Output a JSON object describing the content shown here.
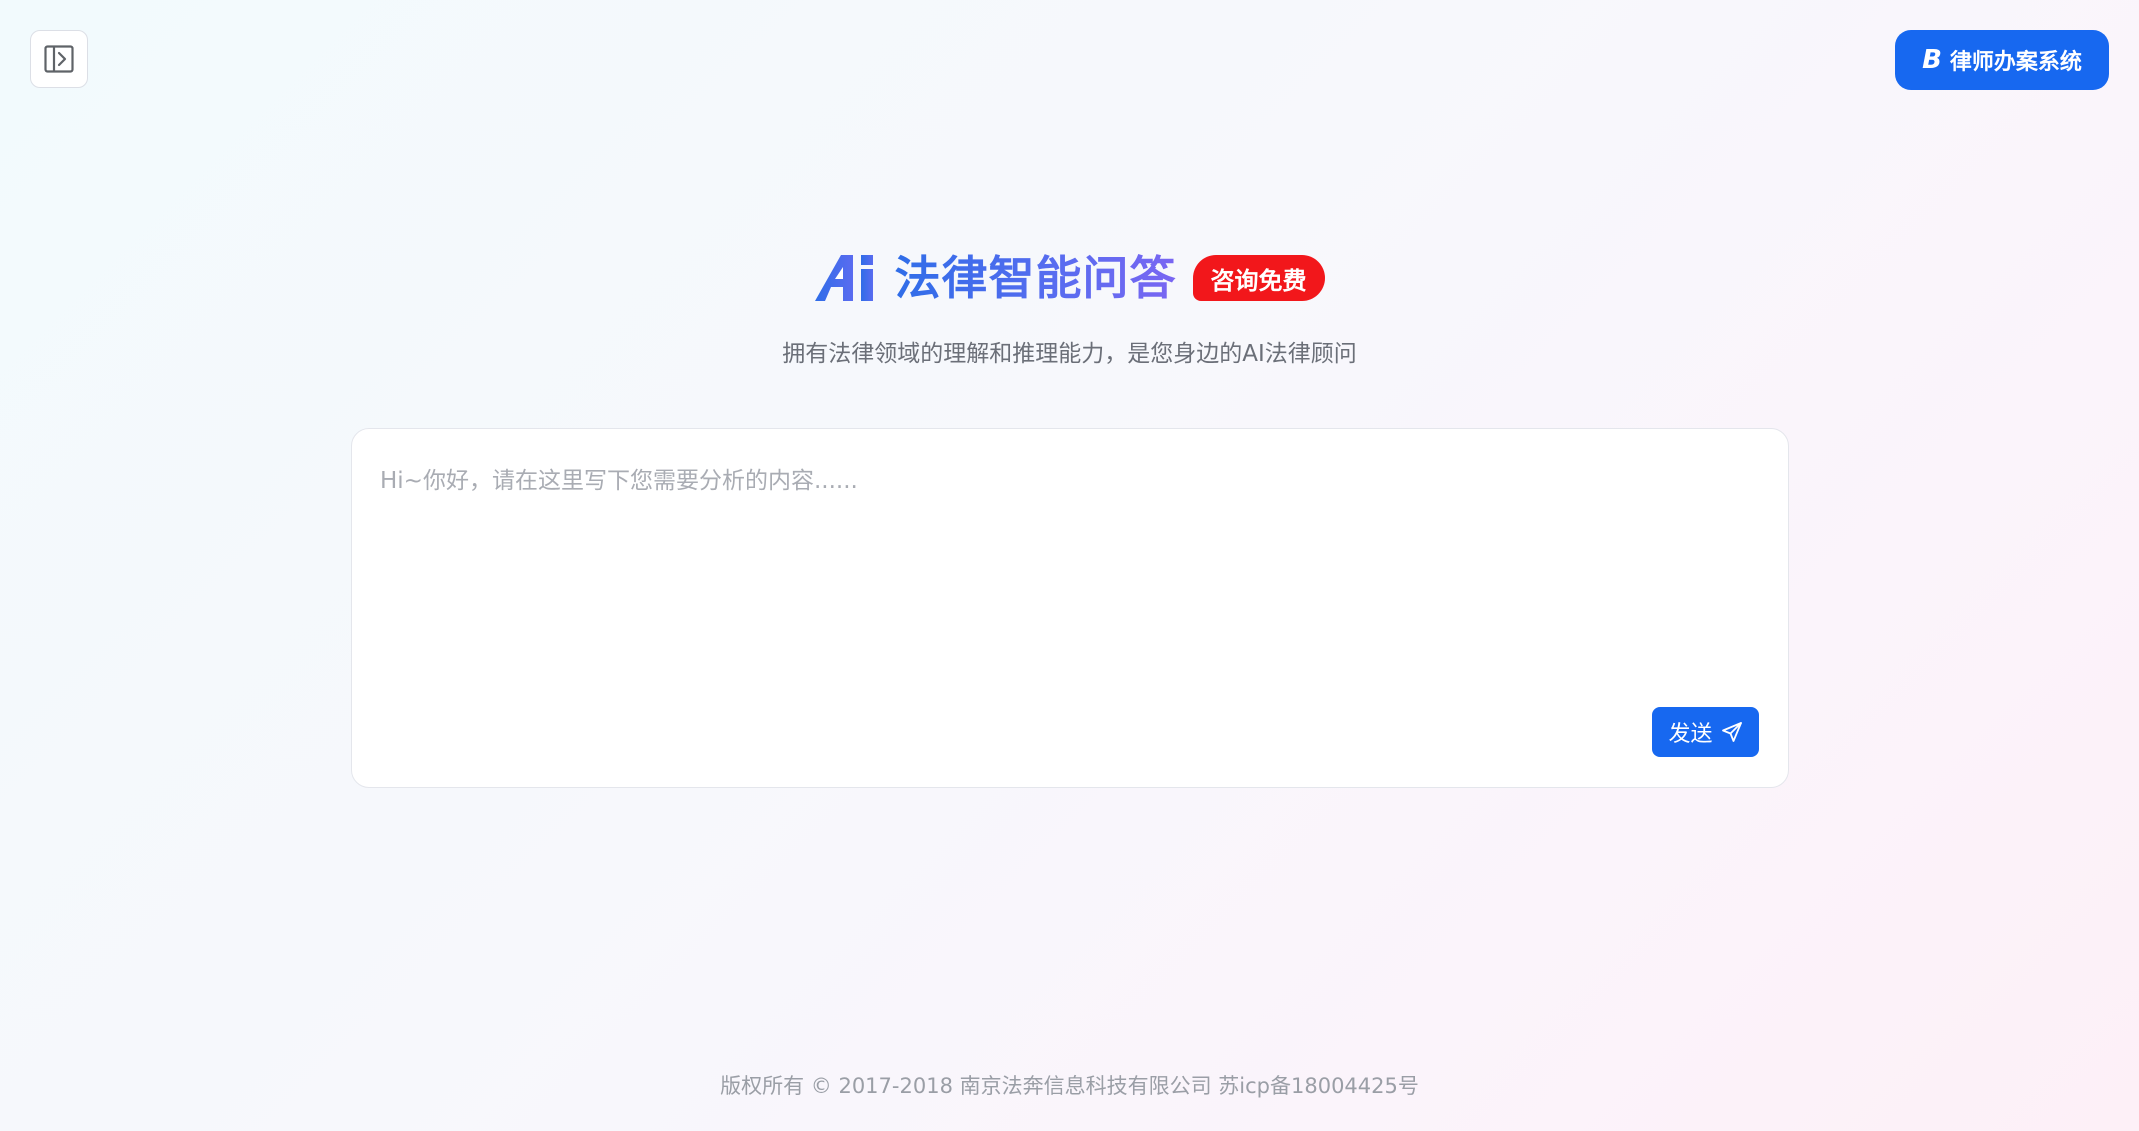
{
  "header": {
    "sidebar_toggle_icon": "sidebar-expand-icon",
    "lawyer_system": {
      "logo_text": "B",
      "label": "律师办案系统"
    }
  },
  "hero": {
    "logo_text": "Ai",
    "title": "法律智能问答",
    "badge": "咨询免费",
    "subtitle": "拥有法律领域的理解和推理能力，是您身边的AI法律顾问"
  },
  "input": {
    "placeholder": "Hi~你好，请在这里写下您需要分析的内容......",
    "value": "",
    "send_label": "发送",
    "send_icon": "send-icon"
  },
  "footer": {
    "text": "版权所有 © 2017-2018 南京法奔信息科技有限公司 苏icp备18004425号"
  },
  "colors": {
    "primary": "#1768f0",
    "badge_red": "#f2171b",
    "title_gradient_start": "#2f6de8",
    "title_gradient_end": "#7a66f2"
  }
}
